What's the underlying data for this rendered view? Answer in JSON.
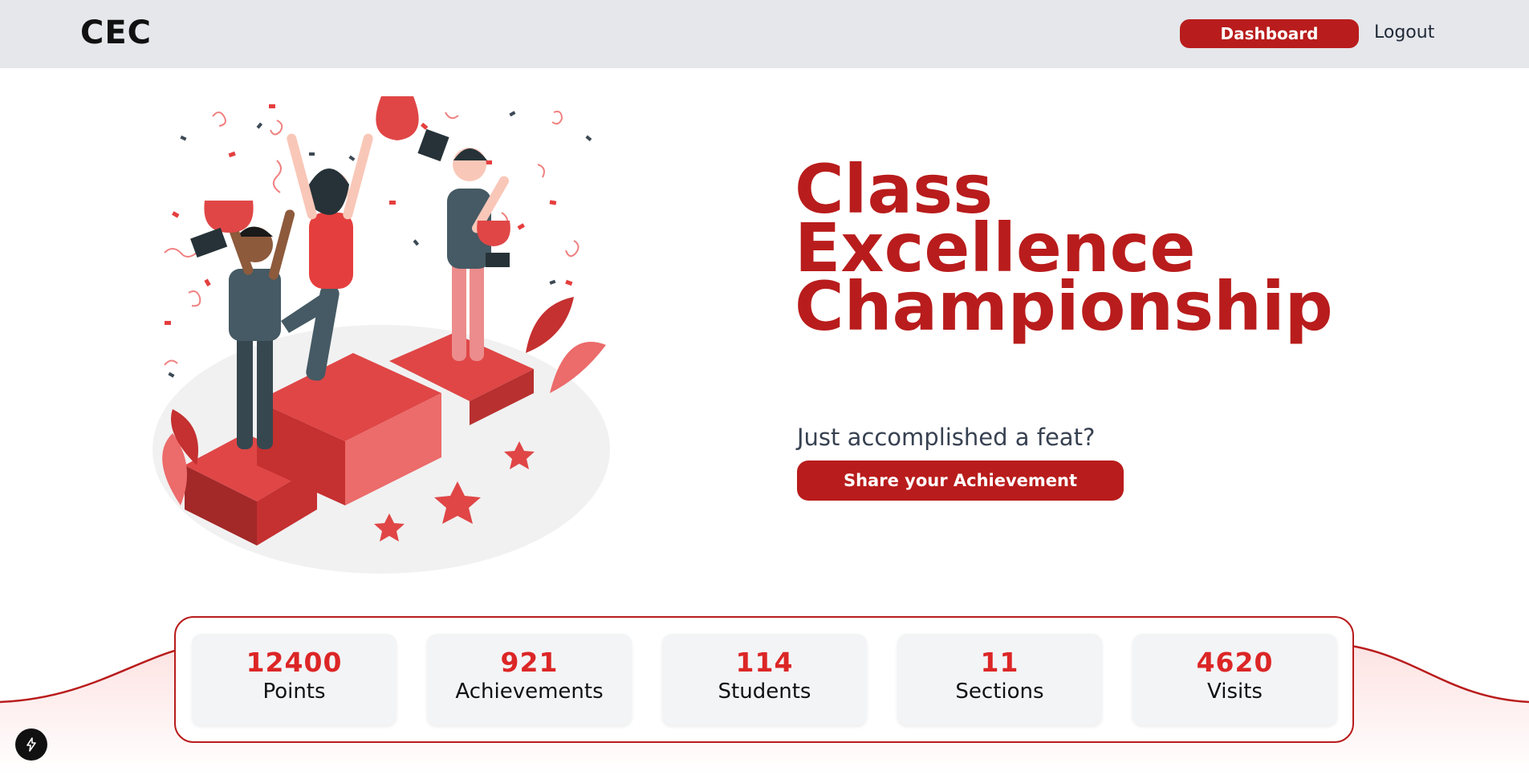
{
  "header": {
    "brand": "CEC",
    "dashboard_label": "Dashboard",
    "logout_label": "Logout"
  },
  "hero": {
    "title_lines": [
      "Class",
      "Excellence",
      "Championship"
    ],
    "question": "Just accomplished a feat?",
    "share_label": "Share your Achievement"
  },
  "stats": [
    {
      "value": "12400",
      "label": "Points"
    },
    {
      "value": "921",
      "label": "Achievements"
    },
    {
      "value": "114",
      "label": "Students"
    },
    {
      "value": "11",
      "label": "Sections"
    },
    {
      "value": "4620",
      "label": "Visits"
    }
  ],
  "colors": {
    "brand": "#b91c1c",
    "nav_bg": "#e5e7eb",
    "stat_value": "#dc2626"
  },
  "icons": {
    "dev_indicator": "lightning-bolt-icon"
  }
}
